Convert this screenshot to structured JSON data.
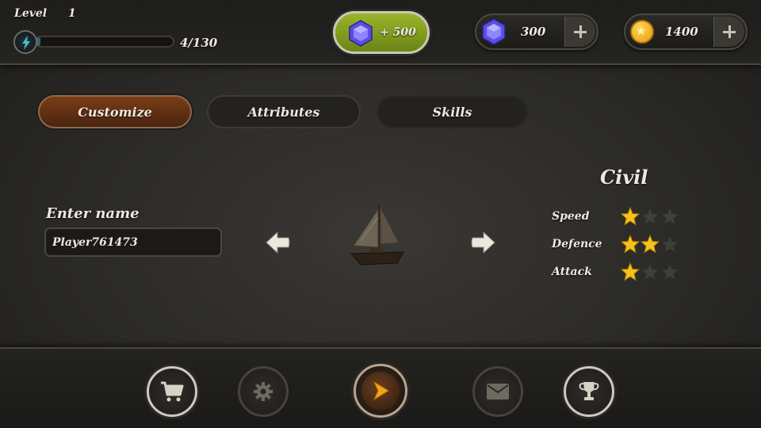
{
  "topbar": {
    "level_label": "Level",
    "level_value": "1",
    "energy_text": "4/130",
    "energy_progress": 0.03,
    "gem_offer": "+ 500",
    "gems": "300",
    "coins": "1400",
    "icons": {
      "energy": "lightning-icon",
      "gem": "gem-icon",
      "coin": "coin-icon",
      "add": "plus-icon"
    }
  },
  "tabs": [
    {
      "label": "Customize",
      "active": true
    },
    {
      "label": "Attributes",
      "active": false
    },
    {
      "label": "Skills",
      "active": false
    }
  ],
  "customize": {
    "name_label": "Enter name",
    "name_value": "Player761473",
    "ship_icon": "sailboat-icon",
    "class_name": "Civil",
    "stats": [
      {
        "label": "Speed",
        "stars": 1,
        "max": 3
      },
      {
        "label": "Defence",
        "stars": 2,
        "max": 3
      },
      {
        "label": "Attack",
        "stars": 1,
        "max": 3
      }
    ]
  },
  "nav": [
    {
      "name": "nav-shop",
      "icon": "cart-icon"
    },
    {
      "name": "nav-settings",
      "icon": "gear-icon"
    },
    {
      "name": "nav-play",
      "icon": "play-icon"
    },
    {
      "name": "nav-mail",
      "icon": "mail-icon"
    },
    {
      "name": "nav-trophy",
      "icon": "trophy-icon"
    }
  ],
  "colors": {
    "active_tab": "#6a3414",
    "gem_offer_green": "#8aa624",
    "star_gold": "#f6c21a",
    "star_empty": "#3d3f38",
    "play_orange": "#f0a01a"
  }
}
